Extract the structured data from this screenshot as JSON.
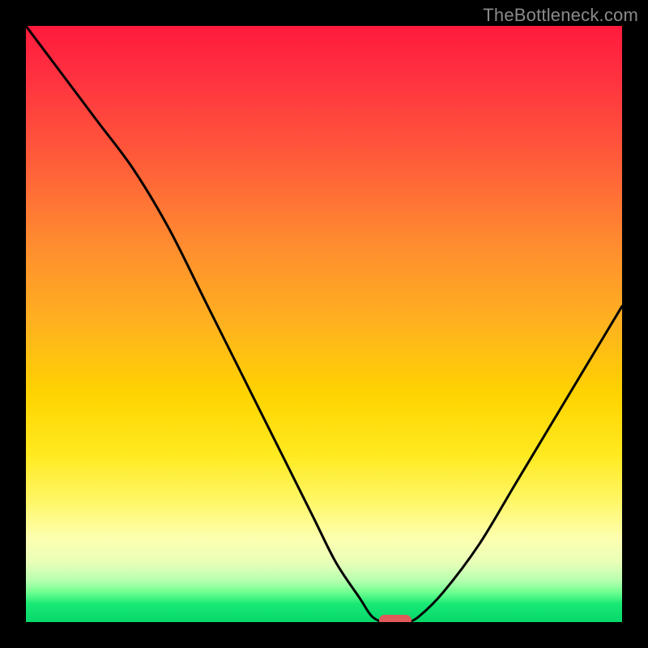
{
  "watermark": {
    "text": "TheBottleneck.com"
  },
  "chart_data": {
    "type": "line",
    "title": "",
    "xlabel": "",
    "ylabel": "",
    "xlim": [
      0,
      100
    ],
    "ylim": [
      0,
      100
    ],
    "grid": false,
    "legend": false,
    "x": [
      0,
      6,
      12,
      18,
      24,
      30,
      36,
      42,
      48,
      52,
      56,
      58,
      60,
      62,
      64,
      66,
      70,
      76,
      82,
      88,
      94,
      100
    ],
    "values": [
      100,
      92,
      84,
      76,
      66,
      54,
      42,
      30,
      18,
      10,
      4,
      1,
      0,
      0,
      0,
      1,
      5,
      13,
      23,
      33,
      43,
      53
    ],
    "marker": {
      "x": 62,
      "y": 0
    },
    "background_gradient": {
      "top_color": "#ff1a3d",
      "mid_color": "#ffd400",
      "bottom_color": "#06d86a"
    }
  }
}
